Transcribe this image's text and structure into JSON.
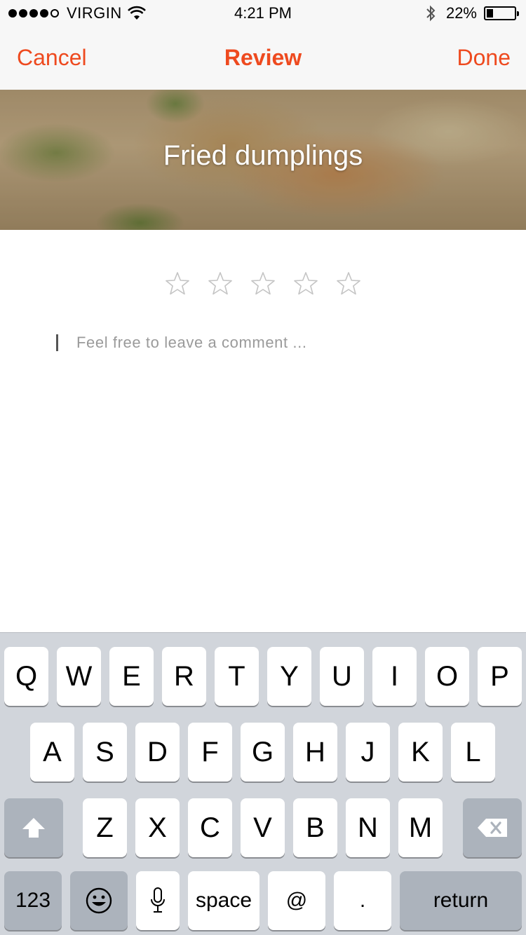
{
  "status_bar": {
    "carrier": "VIRGIN",
    "time": "4:21 PM",
    "battery_text": "22%",
    "battery_level": 0.22,
    "signal_bars": 4
  },
  "nav": {
    "cancel_label": "Cancel",
    "title": "Review",
    "done_label": "Done"
  },
  "hero": {
    "title": "Fried dumplings"
  },
  "rating": {
    "max": 5,
    "value": 0
  },
  "comment": {
    "placeholder": "Feel free to leave a comment ...",
    "value": ""
  },
  "keyboard": {
    "row1": [
      "Q",
      "W",
      "E",
      "R",
      "T",
      "Y",
      "U",
      "I",
      "O",
      "P"
    ],
    "row2": [
      "A",
      "S",
      "D",
      "F",
      "G",
      "H",
      "J",
      "K",
      "L"
    ],
    "row3": [
      "Z",
      "X",
      "C",
      "V",
      "B",
      "N",
      "M"
    ],
    "numbers_label": "123",
    "space_label": "space",
    "at_label": "@",
    "period_label": ".",
    "return_label": "return"
  },
  "colors": {
    "accent": "#ee4a1f"
  },
  "icons": [
    "wifi-icon",
    "bluetooth-icon",
    "battery-icon",
    "star-icon",
    "shift-icon",
    "delete-icon",
    "emoji-icon",
    "microphone-icon"
  ]
}
